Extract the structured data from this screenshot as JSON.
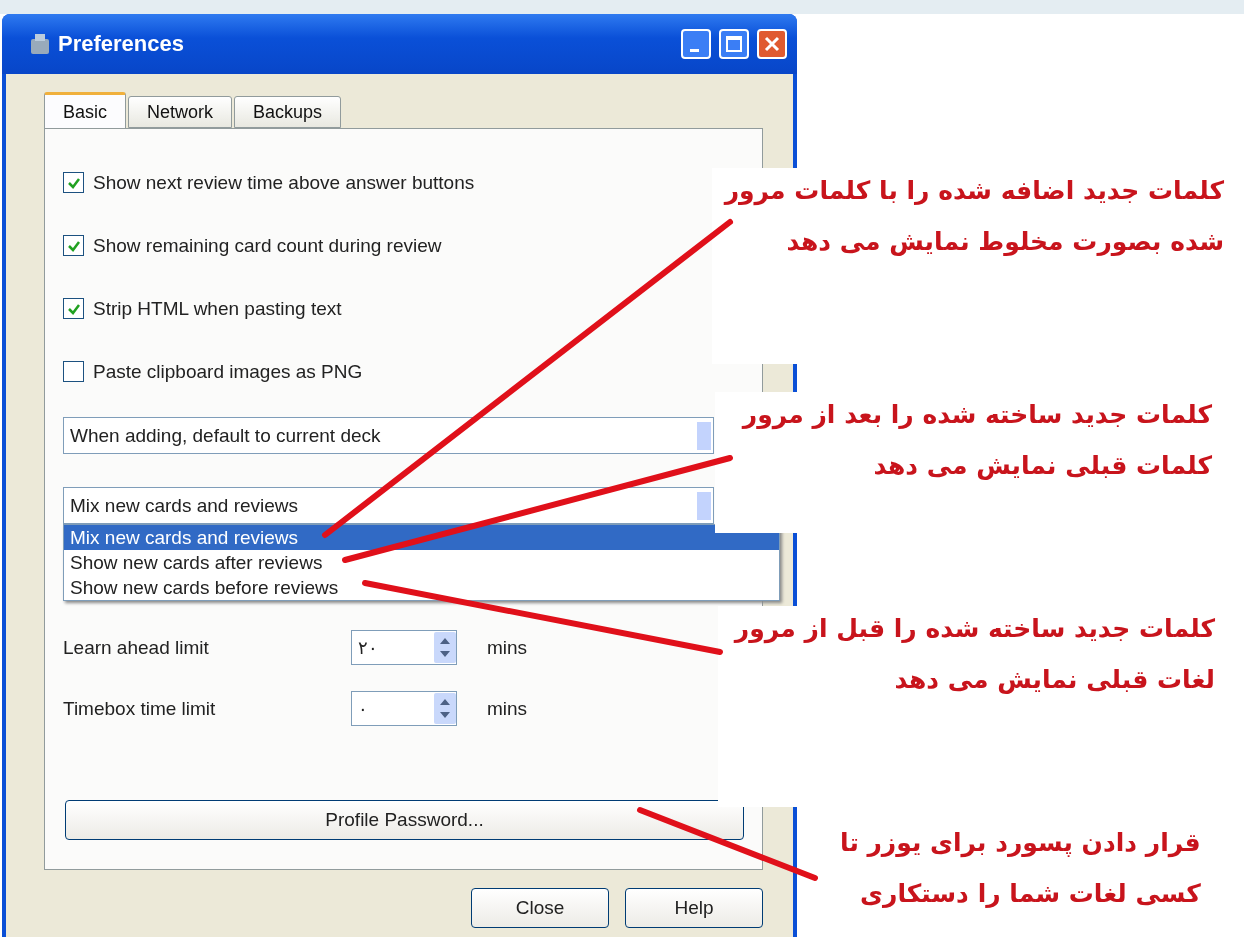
{
  "window": {
    "title": "Preferences"
  },
  "tabs": [
    {
      "label": "Basic",
      "selected": true
    },
    {
      "label": "Network",
      "selected": false
    },
    {
      "label": "Backups",
      "selected": false
    }
  ],
  "checkboxes": [
    {
      "label": "Show next review time above answer buttons",
      "checked": true
    },
    {
      "label": "Show remaining card count during review",
      "checked": true
    },
    {
      "label": "Strip HTML when pasting text",
      "checked": true
    },
    {
      "label": "Paste clipboard images as PNG",
      "checked": false
    }
  ],
  "deck_combo": {
    "value": "When adding, default to current deck"
  },
  "order_combo": {
    "value": "Mix new cards and reviews",
    "expanded": true,
    "options": [
      {
        "label": "Mix new cards and reviews",
        "selected": true
      },
      {
        "label": "Show new cards after reviews",
        "selected": false
      },
      {
        "label": "Show new cards before reviews",
        "selected": false
      }
    ]
  },
  "spinners": [
    {
      "label": "Learn ahead limit",
      "value": "۲۰",
      "unit": "mins"
    },
    {
      "label": "Timebox time limit",
      "value": "۰",
      "unit": "mins"
    }
  ],
  "profile_button": "Profile Password...",
  "buttons": [
    "Close",
    "Help"
  ],
  "annotations": [
    {
      "lines": [
        "کلمات جدید اضافه شده را با کلمات مرور",
        "شده بصورت مخلوط نمایش می دهد"
      ]
    },
    {
      "lines": [
        "کلمات جدید ساخته شده را بعد از مرور",
        "کلمات قبلی نمایش می دهد"
      ]
    },
    {
      "lines": [
        "کلمات جدید ساخته شده را قبل از مرور",
        "لغات قبلی نمایش می دهد"
      ]
    },
    {
      "lines": [
        "قرار دادن پسورد برای یوزر تا",
        "کسی لغات شما را دستکاری"
      ]
    }
  ]
}
